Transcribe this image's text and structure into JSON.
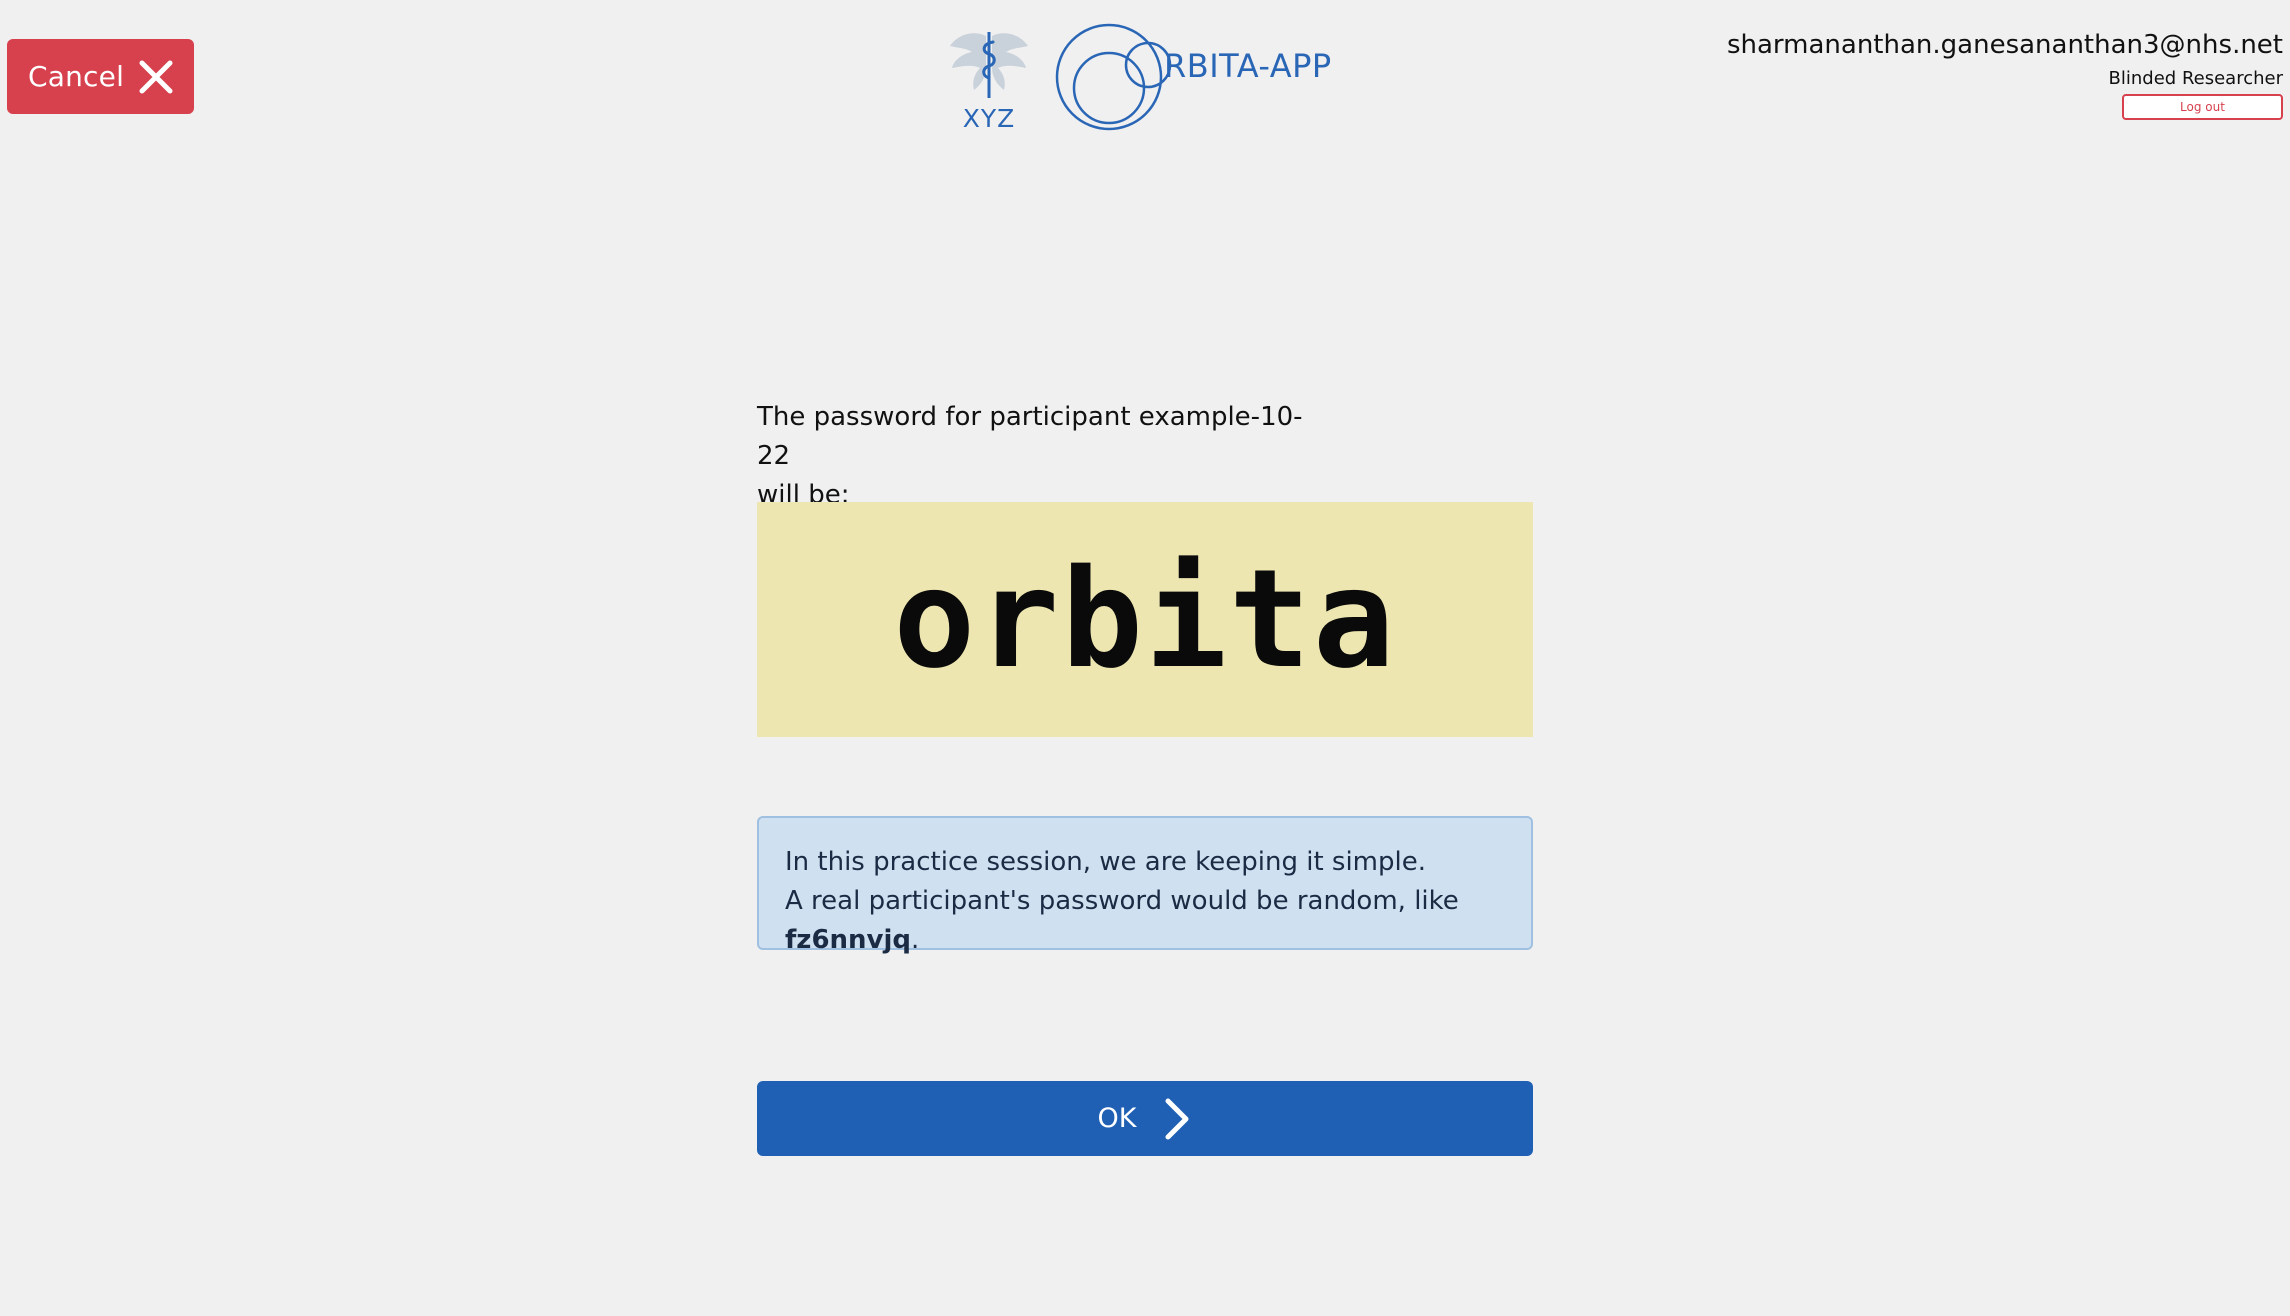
{
  "header": {
    "cancel_label": "Cancel",
    "logo_left_text": "XYZ",
    "logo_right_text": "RBITA-APP",
    "user_email": "sharmananthan.ganesananthan3@nhs.net",
    "user_role": "Blinded Researcher",
    "logout_label": "Log out"
  },
  "main": {
    "intro_line1": "The password for participant example-10-22",
    "intro_line2": "will be:",
    "password": "orbita",
    "info_line1": "In this practice session, we are keeping it simple.",
    "info_line2_prefix": "A real participant's password would be random, like ",
    "info_example": "fz6nnvjq",
    "info_line2_suffix": ".",
    "ok_label": "OK"
  },
  "icons": {
    "cancel": "close-icon",
    "ok": "chevron-right-icon",
    "logo_left": "caduceus-icon",
    "logo_right": "orbita-circles-icon"
  },
  "colors": {
    "page_background": "#f0f0f0",
    "cancel_button": "#d7414d",
    "password_box": "#ede6b1",
    "info_box": "#cfe0f0",
    "ok_button": "#2060b4",
    "brand_blue": "#2a66b6"
  }
}
